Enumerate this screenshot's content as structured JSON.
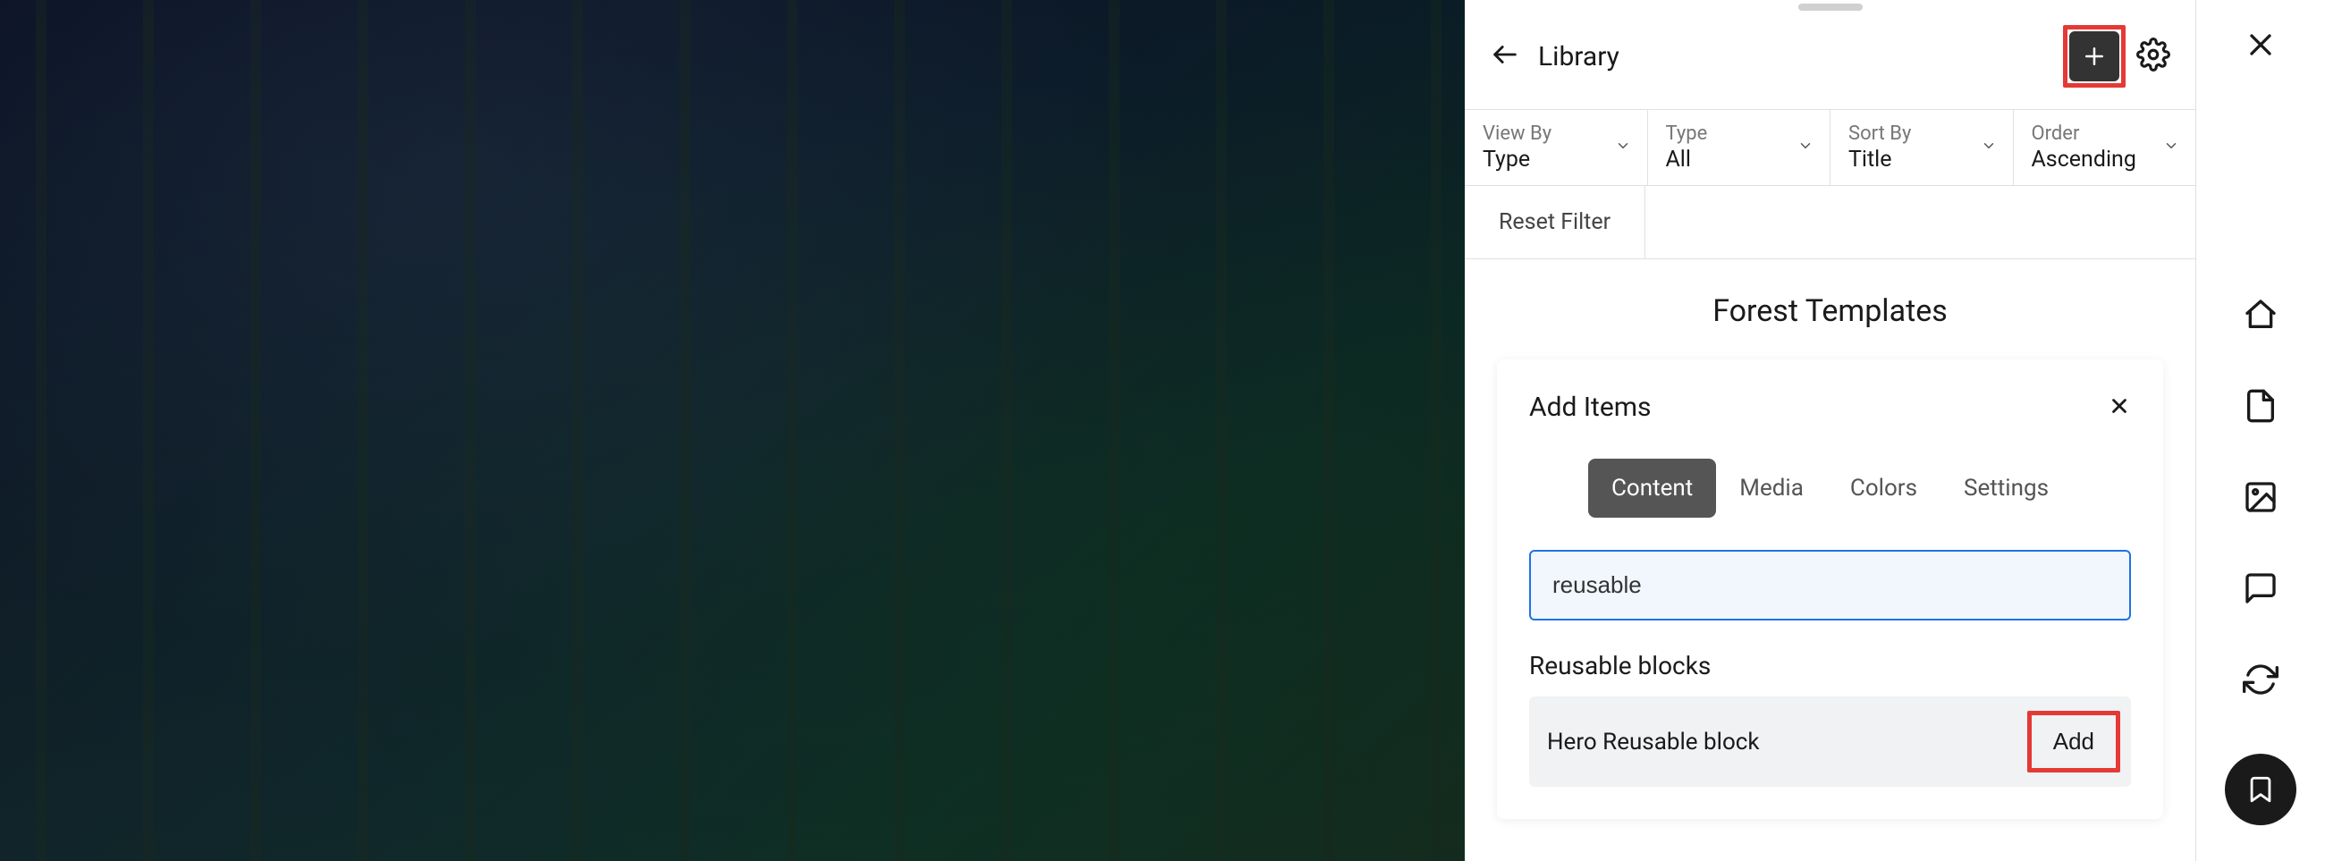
{
  "panel": {
    "title": "Library",
    "filters": {
      "view_by": {
        "label": "View By",
        "value": "Type"
      },
      "type": {
        "label": "Type",
        "value": "All"
      },
      "sort_by": {
        "label": "Sort By",
        "value": "Title"
      },
      "order": {
        "label": "Order",
        "value": "Ascending"
      }
    },
    "reset_label": "Reset Filter",
    "section_title": "Forest Templates"
  },
  "add_items": {
    "title": "Add Items",
    "tabs": {
      "content": "Content",
      "media": "Media",
      "colors": "Colors",
      "settings": "Settings"
    },
    "active_tab": "content",
    "search_value": "reusable",
    "group_title": "Reusable blocks",
    "results": [
      {
        "name": "Hero Reusable block",
        "action": "Add"
      }
    ]
  },
  "icons": {
    "back": "back-arrow",
    "plus": "plus",
    "gear": "settings",
    "chevron": "chevron-down",
    "close": "close",
    "home": "home",
    "page": "page",
    "image": "image",
    "comment": "comment",
    "sync": "sync",
    "bookmark": "bookmark"
  },
  "colors": {
    "highlight": "#e53935",
    "accent": "#1e73e8",
    "dark_button": "#333333"
  }
}
